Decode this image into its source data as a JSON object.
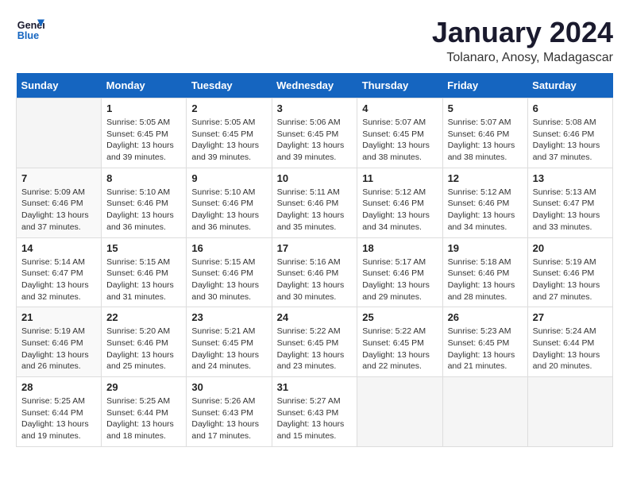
{
  "logo": {
    "line1": "General",
    "line2": "Blue"
  },
  "title": "January 2024",
  "subtitle": "Tolanaro, Anosy, Madagascar",
  "days_header": [
    "Sunday",
    "Monday",
    "Tuesday",
    "Wednesday",
    "Thursday",
    "Friday",
    "Saturday"
  ],
  "weeks": [
    [
      {
        "num": "",
        "info": ""
      },
      {
        "num": "1",
        "info": "Sunrise: 5:05 AM\nSunset: 6:45 PM\nDaylight: 13 hours\nand 39 minutes."
      },
      {
        "num": "2",
        "info": "Sunrise: 5:05 AM\nSunset: 6:45 PM\nDaylight: 13 hours\nand 39 minutes."
      },
      {
        "num": "3",
        "info": "Sunrise: 5:06 AM\nSunset: 6:45 PM\nDaylight: 13 hours\nand 39 minutes."
      },
      {
        "num": "4",
        "info": "Sunrise: 5:07 AM\nSunset: 6:45 PM\nDaylight: 13 hours\nand 38 minutes."
      },
      {
        "num": "5",
        "info": "Sunrise: 5:07 AM\nSunset: 6:46 PM\nDaylight: 13 hours\nand 38 minutes."
      },
      {
        "num": "6",
        "info": "Sunrise: 5:08 AM\nSunset: 6:46 PM\nDaylight: 13 hours\nand 37 minutes."
      }
    ],
    [
      {
        "num": "7",
        "info": "Sunrise: 5:09 AM\nSunset: 6:46 PM\nDaylight: 13 hours\nand 37 minutes."
      },
      {
        "num": "8",
        "info": "Sunrise: 5:10 AM\nSunset: 6:46 PM\nDaylight: 13 hours\nand 36 minutes."
      },
      {
        "num": "9",
        "info": "Sunrise: 5:10 AM\nSunset: 6:46 PM\nDaylight: 13 hours\nand 36 minutes."
      },
      {
        "num": "10",
        "info": "Sunrise: 5:11 AM\nSunset: 6:46 PM\nDaylight: 13 hours\nand 35 minutes."
      },
      {
        "num": "11",
        "info": "Sunrise: 5:12 AM\nSunset: 6:46 PM\nDaylight: 13 hours\nand 34 minutes."
      },
      {
        "num": "12",
        "info": "Sunrise: 5:12 AM\nSunset: 6:46 PM\nDaylight: 13 hours\nand 34 minutes."
      },
      {
        "num": "13",
        "info": "Sunrise: 5:13 AM\nSunset: 6:47 PM\nDaylight: 13 hours\nand 33 minutes."
      }
    ],
    [
      {
        "num": "14",
        "info": "Sunrise: 5:14 AM\nSunset: 6:47 PM\nDaylight: 13 hours\nand 32 minutes."
      },
      {
        "num": "15",
        "info": "Sunrise: 5:15 AM\nSunset: 6:46 PM\nDaylight: 13 hours\nand 31 minutes."
      },
      {
        "num": "16",
        "info": "Sunrise: 5:15 AM\nSunset: 6:46 PM\nDaylight: 13 hours\nand 30 minutes."
      },
      {
        "num": "17",
        "info": "Sunrise: 5:16 AM\nSunset: 6:46 PM\nDaylight: 13 hours\nand 30 minutes."
      },
      {
        "num": "18",
        "info": "Sunrise: 5:17 AM\nSunset: 6:46 PM\nDaylight: 13 hours\nand 29 minutes."
      },
      {
        "num": "19",
        "info": "Sunrise: 5:18 AM\nSunset: 6:46 PM\nDaylight: 13 hours\nand 28 minutes."
      },
      {
        "num": "20",
        "info": "Sunrise: 5:19 AM\nSunset: 6:46 PM\nDaylight: 13 hours\nand 27 minutes."
      }
    ],
    [
      {
        "num": "21",
        "info": "Sunrise: 5:19 AM\nSunset: 6:46 PM\nDaylight: 13 hours\nand 26 minutes."
      },
      {
        "num": "22",
        "info": "Sunrise: 5:20 AM\nSunset: 6:46 PM\nDaylight: 13 hours\nand 25 minutes."
      },
      {
        "num": "23",
        "info": "Sunrise: 5:21 AM\nSunset: 6:45 PM\nDaylight: 13 hours\nand 24 minutes."
      },
      {
        "num": "24",
        "info": "Sunrise: 5:22 AM\nSunset: 6:45 PM\nDaylight: 13 hours\nand 23 minutes."
      },
      {
        "num": "25",
        "info": "Sunrise: 5:22 AM\nSunset: 6:45 PM\nDaylight: 13 hours\nand 22 minutes."
      },
      {
        "num": "26",
        "info": "Sunrise: 5:23 AM\nSunset: 6:45 PM\nDaylight: 13 hours\nand 21 minutes."
      },
      {
        "num": "27",
        "info": "Sunrise: 5:24 AM\nSunset: 6:44 PM\nDaylight: 13 hours\nand 20 minutes."
      }
    ],
    [
      {
        "num": "28",
        "info": "Sunrise: 5:25 AM\nSunset: 6:44 PM\nDaylight: 13 hours\nand 19 minutes."
      },
      {
        "num": "29",
        "info": "Sunrise: 5:25 AM\nSunset: 6:44 PM\nDaylight: 13 hours\nand 18 minutes."
      },
      {
        "num": "30",
        "info": "Sunrise: 5:26 AM\nSunset: 6:43 PM\nDaylight: 13 hours\nand 17 minutes."
      },
      {
        "num": "31",
        "info": "Sunrise: 5:27 AM\nSunset: 6:43 PM\nDaylight: 13 hours\nand 15 minutes."
      },
      {
        "num": "",
        "info": ""
      },
      {
        "num": "",
        "info": ""
      },
      {
        "num": "",
        "info": ""
      }
    ]
  ]
}
